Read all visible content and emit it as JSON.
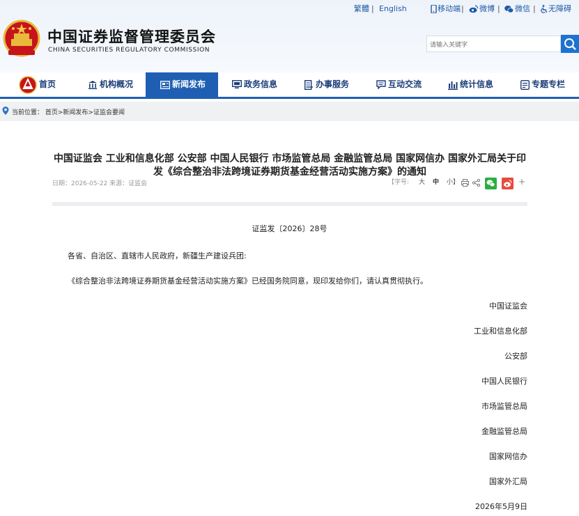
{
  "header": {
    "title_cn": "中国证券监督管理委员会",
    "title_en": "CHINA SECURITIES REGULATORY COMMISSION",
    "toplinks": {
      "traditional": "繁體",
      "english": "English",
      "mobile": "移动端",
      "weibo": "微博",
      "wechat": "微信",
      "accessibility": "无障碍"
    },
    "search_placeholder": "请输入关键字"
  },
  "nav": {
    "items": [
      {
        "label": "首页",
        "icon": "home-emblem-icon"
      },
      {
        "label": "机构概况",
        "icon": "institution-icon"
      },
      {
        "label": "新闻发布",
        "icon": "news-icon",
        "active": true
      },
      {
        "label": "政务信息",
        "icon": "monitor-icon"
      },
      {
        "label": "办事服务",
        "icon": "document-icon"
      },
      {
        "label": "互动交流",
        "icon": "chat-icon"
      },
      {
        "label": "统计信息",
        "icon": "bar-chart-icon"
      },
      {
        "label": "专题专栏",
        "icon": "column-icon"
      }
    ]
  },
  "breadcrumb": {
    "prefix": "当前位置：",
    "path": "首页>新闻发布>证监会要闻"
  },
  "article": {
    "title": "中国证监会 工业和信息化部 公安部 中国人民银行 市场监管总局 金融监管总局 国家网信办 国家外汇局关于印发《综合整治非法跨境证券期货基金经营活动实施方案》的通知",
    "meta": "日期：2026-05-22 来源：证监会",
    "font_size": {
      "open": "【字号:",
      "large": "大",
      "medium": "中",
      "small": "小】"
    },
    "doc_number": "证监发〔2026〕28号",
    "salutation": "各省、自治区、直辖市人民政府，新疆生产建设兵团:",
    "body": "《综合整治非法跨境证券期货基金经营活动实施方案》已经国务院同意，现印发给你们，请认真贯彻执行。",
    "signatories": [
      "中国证监会",
      "工业和信息化部",
      "公安部",
      "中国人民银行",
      "市场监管总局",
      "金融监管总局",
      "国家网信办",
      "国家外汇局"
    ],
    "date": "2026年5月9日"
  },
  "colors": {
    "nav_active": "#1e5fb3",
    "link_blue": "#1f5aa5",
    "wechat_green": "#2aae3f",
    "weibo_red": "#e64b3c"
  }
}
